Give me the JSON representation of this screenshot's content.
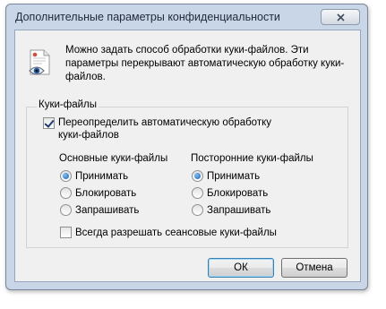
{
  "window": {
    "title": "Дополнительные параметры конфиденциальности"
  },
  "description": "Можно задать способ обработки куки-файлов. Эти параметры перекрывают автоматическую обработку куки-файлов.",
  "cookies_group": {
    "legend": "Куки-файлы",
    "override_checkbox": {
      "label": "Переопределить автоматическую обработку куки-файлов",
      "checked": true
    },
    "first_party": {
      "heading": "Основные куки-файлы",
      "options": [
        "Принимать",
        "Блокировать",
        "Запрашивать"
      ],
      "selected": "Принимать"
    },
    "third_party": {
      "heading": "Посторонние куки-файлы",
      "options": [
        "Принимать",
        "Блокировать",
        "Запрашивать"
      ],
      "selected": "Принимать"
    },
    "session_checkbox": {
      "label": "Всегда разрешать сеансовые куки-файлы",
      "checked": false
    }
  },
  "buttons": {
    "ok": "ОК",
    "cancel": "Отмена"
  },
  "icons": {
    "header": "privacy-document-eye-icon",
    "close": "close-icon"
  },
  "colors": {
    "title_bar": "#c9d6e8",
    "client_bg": "#f0f0f0",
    "radio_accent": "#1a5fb4"
  }
}
